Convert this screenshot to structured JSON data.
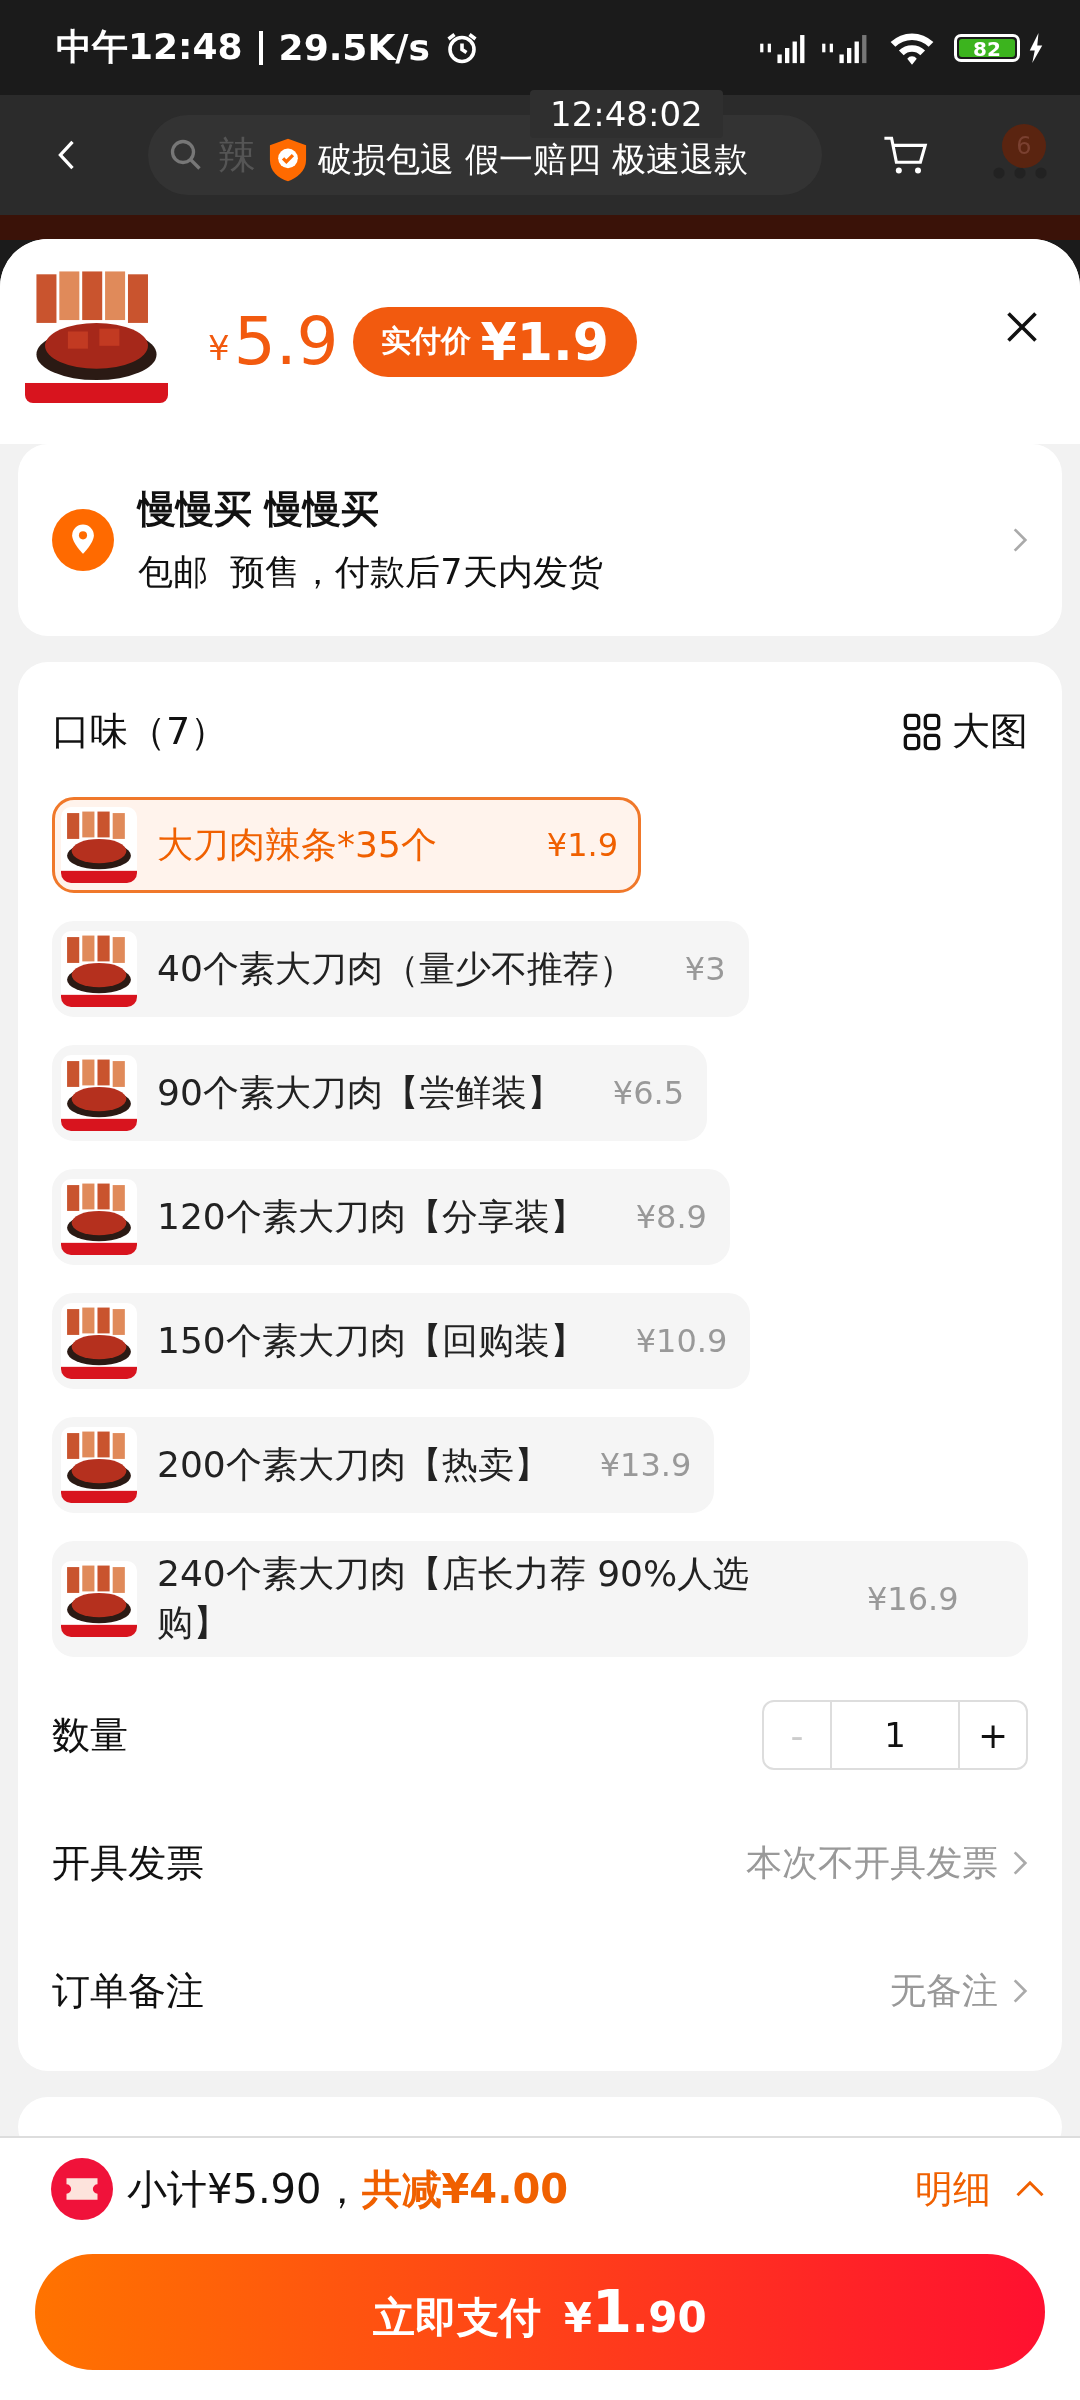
{
  "status_bar": {
    "time": "中午12:48",
    "speed": "29.5K/s",
    "battery": "82"
  },
  "nav": {
    "search_text": "辣",
    "cart_badge": "6"
  },
  "overlay": {
    "timer": "12:48:02",
    "guarantee": "破损包退 假一赔四 极速退款"
  },
  "product": {
    "price_symbol": "¥",
    "price": "5.9",
    "pay_label": "实付价",
    "pay_price": "¥1.9"
  },
  "address": {
    "name": "慢慢买 慢慢买",
    "detail": "包邮  预售，付款后7天内发货"
  },
  "options": {
    "title": "口味（7）",
    "view_toggle": "大图",
    "items": [
      {
        "label": "大刀肉辣条*35个",
        "price": "¥1.9",
        "selected": true
      },
      {
        "label": "40个素大刀肉（量少不推荐）",
        "price": "¥3",
        "selected": false
      },
      {
        "label": "90个素大刀肉【尝鲜装】",
        "price": "¥6.5",
        "selected": false
      },
      {
        "label": "120个素大刀肉【分享装】",
        "price": "¥8.9",
        "selected": false
      },
      {
        "label": "150个素大刀肉【回购装】",
        "price": "¥10.9",
        "selected": false
      },
      {
        "label": "200个素大刀肉【热卖】",
        "price": "¥13.9",
        "selected": false
      },
      {
        "label": "240个素大刀肉【店长力荐 90%人选购】",
        "price": "¥16.9",
        "selected": false
      }
    ]
  },
  "quantity": {
    "label": "数量",
    "minus": "-",
    "value": "1",
    "plus": "+"
  },
  "invoice": {
    "label": "开具发票",
    "value": "本次不开具发票"
  },
  "remark": {
    "label": "订单备注",
    "value": "无备注"
  },
  "summary": {
    "subtotal": "小计¥5.90，",
    "discount": "共减¥4.00",
    "details": "明细"
  },
  "pay_button": {
    "label": "立即支付",
    "symbol": "¥",
    "integer": "1",
    "decimal": ".90"
  }
}
